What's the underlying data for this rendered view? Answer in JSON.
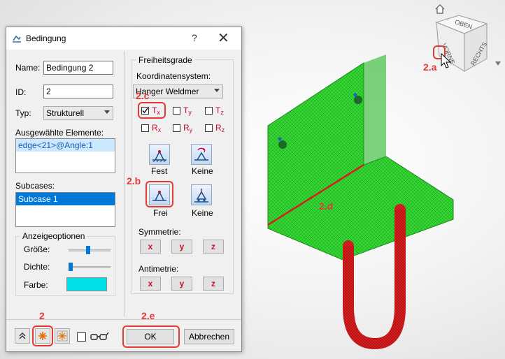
{
  "dialog": {
    "title": "Bedingung",
    "help_label": "?",
    "close_label": "✕",
    "name_label": "Name:",
    "name_value": "Bedingung 2",
    "id_label": "ID:",
    "id_value": "2",
    "type_label": "Typ:",
    "type_value": "Strukturell",
    "selected_label": "Ausgewählte Elemente:",
    "selected_items": [
      "edge<21>@Angle:1"
    ],
    "subcases_label": "Subcases:",
    "subcases_items": [
      "Subcase 1"
    ],
    "display_group": "Anzeigeoptionen",
    "size_label": "Größe:",
    "size_value": 0.55,
    "density_label": "Dichte:",
    "density_value": 0.0,
    "color_label": "Farbe:",
    "color_value": "#00e0e6",
    "freedom_group": "Freiheitsgrade",
    "coord_label": "Koordinatensystem:",
    "coord_value": "Hanger Weldmer",
    "dof": {
      "tx": {
        "main": "T",
        "sub": "x",
        "checked": true
      },
      "ty": {
        "main": "T",
        "sub": "y",
        "checked": false
      },
      "tz": {
        "main": "T",
        "sub": "z",
        "checked": false
      },
      "rx": {
        "main": "R",
        "sub": "x",
        "checked": false
      },
      "ry": {
        "main": "R",
        "sub": "y",
        "checked": false
      },
      "rz": {
        "main": "R",
        "sub": "z",
        "checked": false
      }
    },
    "fest_label": "Fest",
    "keine1_label": "Keine",
    "frei_label": "Frei",
    "keine2_label": "Keine",
    "symmetry_label": "Symmetrie:",
    "antisymmetry_label": "Antimetrie:",
    "axis_x": "x",
    "axis_y": "y",
    "axis_z": "z",
    "ok_label": "OK",
    "cancel_label": "Abbrechen"
  },
  "viewcube": {
    "top_face": "OBEN",
    "front_face": "VORNE",
    "right_face": "RECHTS"
  },
  "annotations": {
    "a": "2.a",
    "b": "2.b",
    "c": "2.c",
    "d": "2.d",
    "e": "2.e",
    "main": "2"
  },
  "colors": {
    "plate": "#2ecc2e",
    "hook": "#e02020",
    "highlight": "#e53935"
  }
}
